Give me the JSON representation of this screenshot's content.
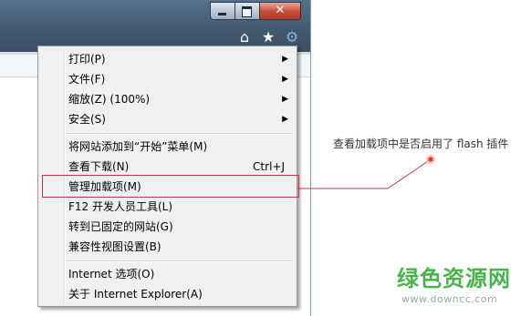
{
  "window": {
    "caption_buttons": [
      {
        "icon": "minimize-icon"
      },
      {
        "icon": "maximize-icon"
      },
      {
        "icon": "close-icon",
        "glyph": "✕"
      }
    ],
    "command_icons": [
      {
        "icon": "home-icon",
        "glyph": "⌂"
      },
      {
        "icon": "favorites-star-icon",
        "glyph": "★"
      },
      {
        "icon": "tools-gear-icon",
        "glyph": "⚙"
      }
    ],
    "frame_color": "#4a6178"
  },
  "tools_menu": {
    "items": [
      {
        "label": "打印(P)",
        "submenu": true
      },
      {
        "label": "文件(F)",
        "submenu": true
      },
      {
        "label": "缩放(Z) (100%)",
        "submenu": true
      },
      {
        "label": "安全(S)",
        "submenu": true
      },
      {
        "label": "将网站添加到“开始”菜单(M)"
      },
      {
        "label": "查看下载(N)",
        "shortcut": "Ctrl+J"
      },
      {
        "label": "管理加载项(M)",
        "highlighted": true
      },
      {
        "label": "F12 开发人员工具(L)"
      },
      {
        "label": "转到已固定的网站(G)"
      },
      {
        "label": "兼容性视图设置(B)"
      },
      {
        "label": "Internet 选项(O)"
      },
      {
        "label": "关于 Internet Explorer(A)"
      }
    ],
    "submenu_arrow": "▶"
  },
  "annotation": {
    "text": "查看加载项中是否启用了 flash 插件",
    "line_color": "#c8354a"
  },
  "watermark": {
    "title": "绿色资源网",
    "url": "www.downcc.com",
    "color": "#46b44a"
  }
}
